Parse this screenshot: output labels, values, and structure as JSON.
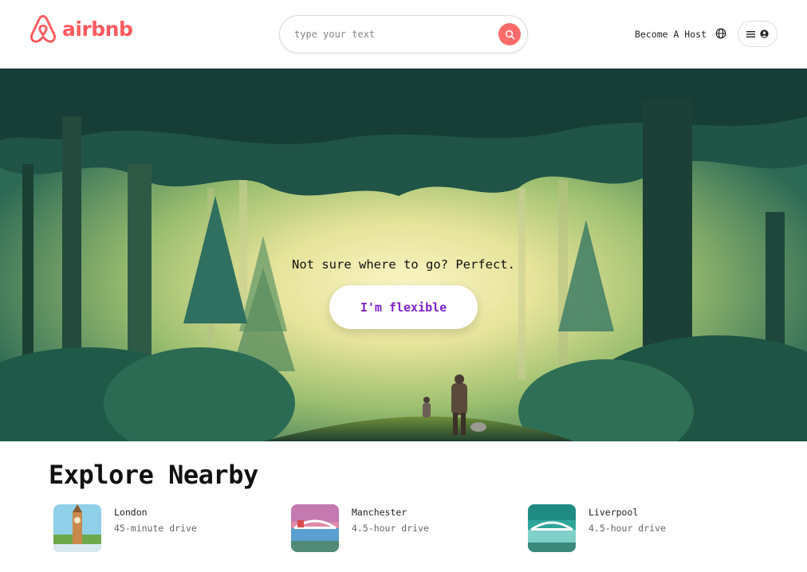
{
  "header": {
    "logo_text": "airbnb",
    "search_placeholder": "type your text",
    "become_host": "Become A Host",
    "icons": [
      "airbnb-logo-icon",
      "search-icon",
      "globe-icon",
      "menu-icon",
      "user-icon"
    ]
  },
  "hero": {
    "tagline": "Not sure where to go? Perfect.",
    "cta_label": "I'm flexible"
  },
  "explore": {
    "title": "Explore Nearby",
    "places": [
      {
        "name": "London",
        "distance": "45-minute drive"
      },
      {
        "name": "Manchester",
        "distance": "4.5-hour drive"
      },
      {
        "name": "Liverpool",
        "distance": "4.5-hour drive"
      }
    ]
  },
  "colors": {
    "brand": "#ff5a5f",
    "search_button": "#ff6b6b",
    "cta_text": "#7f22c9"
  }
}
